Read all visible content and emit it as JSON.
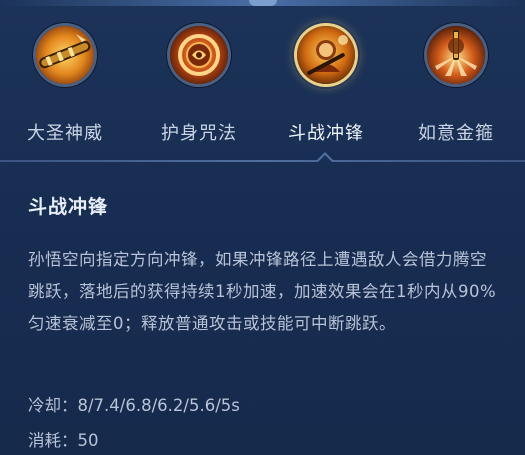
{
  "skills": [
    {
      "name": "大圣神威",
      "icon": "golden-staff-icon",
      "selected": false
    },
    {
      "name": "护身咒法",
      "icon": "spinning-ring-icon",
      "selected": false
    },
    {
      "name": "斗战冲锋",
      "icon": "monkey-king-charge-icon",
      "selected": true
    },
    {
      "name": "如意金箍",
      "icon": "staff-smash-icon",
      "selected": false
    }
  ],
  "detail": {
    "title": "斗战冲锋",
    "description": "孙悟空向指定方向冲锋，如果冲锋路径上遭遇敌人会借力腾空跳跃，落地后的获得持续1秒加速，加速效果会在1秒内从90%匀速衰减至0；释放普通攻击或技能可中断跳跃。",
    "cooldown_label": "冷却：8/7.4/6.8/6.2/5.6/5s",
    "cost_label": "消耗：50"
  },
  "colors": {
    "background": "#182d52",
    "selected_ring": "#e9d38c",
    "text_primary": "#e8eef8",
    "text_secondary": "#b7c3d6"
  }
}
